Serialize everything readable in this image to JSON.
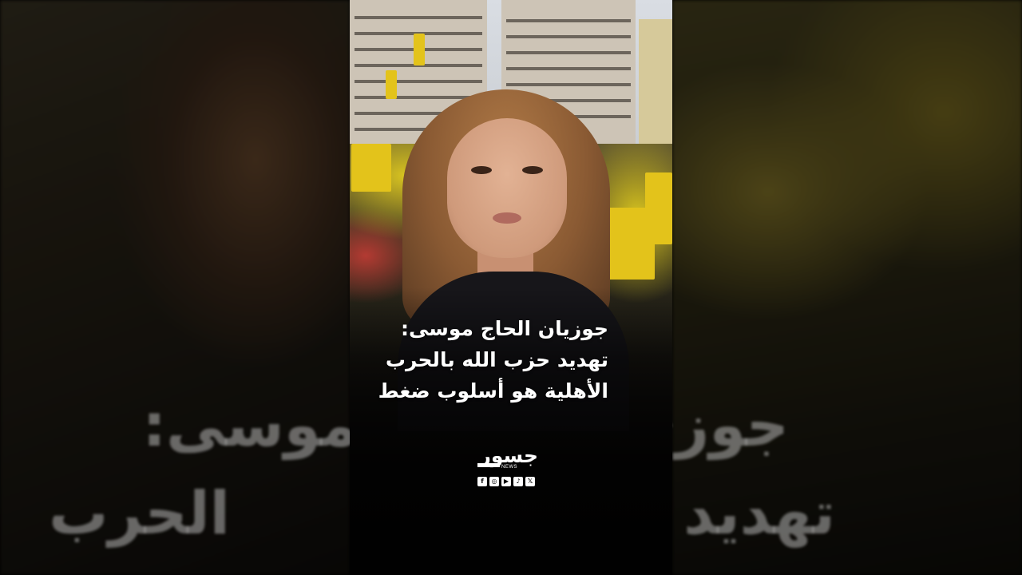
{
  "headline": {
    "line1": "جوزيان الحاج موسى:",
    "line2": "تهديد حزب الله بالحرب",
    "line3": "الأهلية هو أسلوب ضغط"
  },
  "background_text": {
    "left_line1": "موسى:",
    "left_line2": "الحرب",
    "right_line1": "جوزي",
    "right_line2": "تهديد"
  },
  "logo": {
    "arabic": "جسور",
    "latin": "NEWS"
  },
  "socials": [
    {
      "icon": "facebook-icon",
      "glyph": "f"
    },
    {
      "icon": "instagram-icon",
      "glyph": "◎"
    },
    {
      "icon": "youtube-icon",
      "glyph": "▶"
    },
    {
      "icon": "tiktok-icon",
      "glyph": "♪"
    },
    {
      "icon": "x-icon",
      "glyph": "𝕏"
    }
  ],
  "colors": {
    "flag_yellow": "#e3c31b",
    "text": "#ffffff"
  }
}
